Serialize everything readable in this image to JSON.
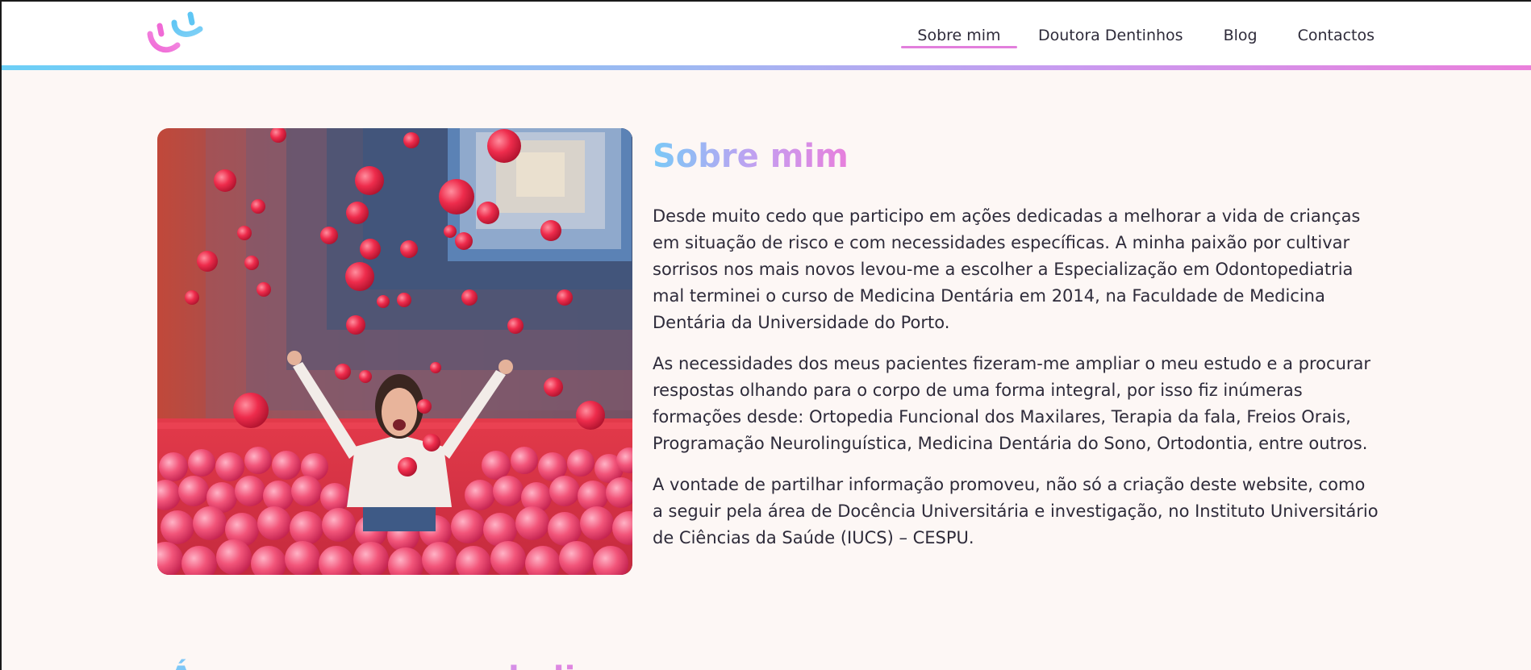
{
  "header": {
    "logo_icon": "smiley-logo-icon",
    "nav": [
      {
        "label": "Sobre mim",
        "active": true
      },
      {
        "label": "Doutora Dentinhos",
        "active": false
      },
      {
        "label": "Blog",
        "active": false
      },
      {
        "label": "Contactos",
        "active": false
      }
    ],
    "accent_gradient": [
      "#6ccff6",
      "#c99af0",
      "#ea7fdb"
    ]
  },
  "about": {
    "title": "Sobre mim",
    "photo_alt": "photo-woman-in-pink-ball-pit",
    "paragraphs": [
      "Desde muito cedo que participo em ações dedicadas a melhorar a vida de crianças em situação de risco e com necessidades específicas. A minha paixão por cultivar sorrisos nos mais novos levou-me a escolher a Especialização em Odontopediatria mal terminei o curso de Medicina Dentária em 2014, na Faculdade de Medicina Dentária da Universidade do Porto.",
      "As necessidades dos meus pacientes fizeram-me ampliar o meu estudo e a procurar respostas olhando para o corpo de uma forma integral, por isso fiz inúmeras formações desde: Ortopedia Funcional dos Maxilares, Terapia da fala, Freios Orais, Programação Neurolinguística, Medicina Dentária do Sono, Ortodontia, entre outros.",
      "A vontade de partilhar informação promoveu, não só a criação deste website, como a seguir pela área de Docência Universitária e investigação, no Instituto Universitário de Ciências da Saúde (IUCS) – CESPU."
    ]
  },
  "next_section": {
    "title": "Áreas em que me dedico"
  }
}
